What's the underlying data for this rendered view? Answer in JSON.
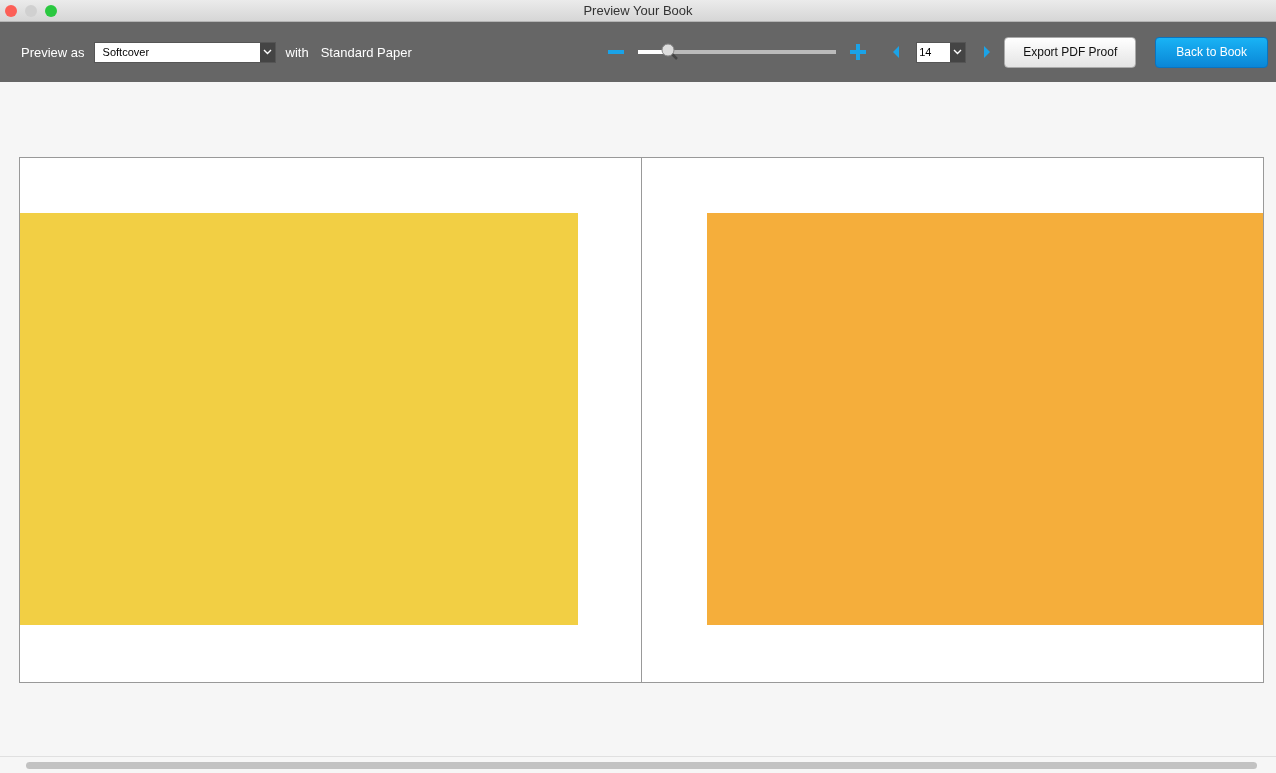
{
  "window": {
    "title": "Preview Your Book"
  },
  "toolbar": {
    "preview_label": "Preview as",
    "format": {
      "value": "Softcover"
    },
    "with_label": "with",
    "paper": "Standard Paper",
    "zoom": {
      "level": 0.17
    },
    "page": {
      "value": "14"
    },
    "buttons": [
      {
        "label": "Export PDF Proof",
        "kind": "secondary"
      },
      {
        "label": "Back to Book",
        "kind": "primary"
      }
    ]
  },
  "spread": [
    {
      "kind": "inset",
      "color": "#f2cf44"
    },
    {
      "kind": "bleed",
      "color": "#f5ae3b"
    }
  ]
}
